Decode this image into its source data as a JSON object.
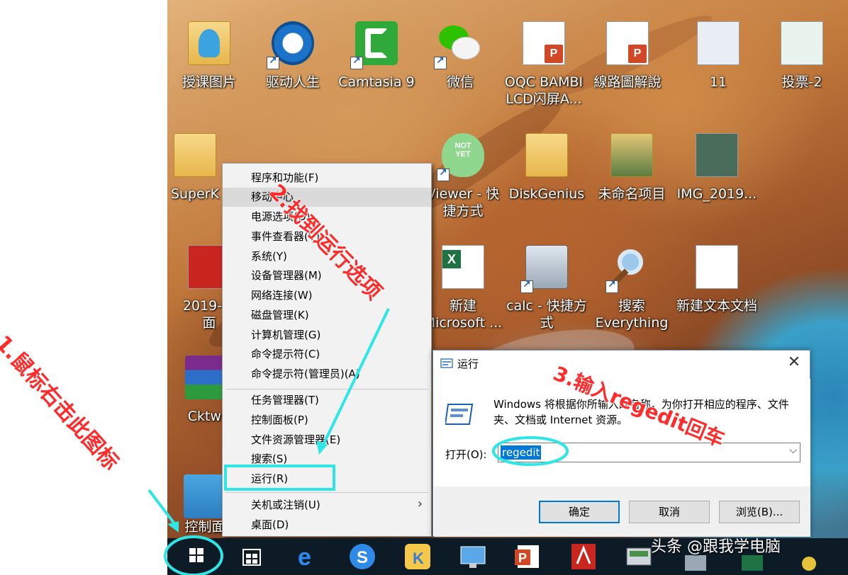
{
  "desktop": {
    "icons": [
      {
        "label": "授课图片",
        "icon": "folder-icon"
      },
      {
        "label": "驱动人生",
        "icon": "gear-icon"
      },
      {
        "label": "Camtasia 9",
        "icon": "camtasia-icon"
      },
      {
        "label": "微信",
        "icon": "wechat-icon"
      },
      {
        "label": "OQC BAMBI\nLCD闪屏A...",
        "icon": "ppt-file-icon"
      },
      {
        "label": "線路圖解說",
        "icon": "ppt-file-icon"
      },
      {
        "label": "11",
        "icon": "image-file-icon"
      },
      {
        "label": "投票-2",
        "icon": "image-file-icon"
      },
      {
        "label": "SuperK",
        "icon": "folder-icon"
      },
      {
        "label": "Viewer - 快\n捷方式",
        "icon": "viewer-icon"
      },
      {
        "label": "DiskGenius",
        "icon": "folder-icon"
      },
      {
        "label": "未命名项目",
        "icon": "folder-icon"
      },
      {
        "label": "IMG_2019...",
        "icon": "image-file-icon"
      },
      {
        "label": "2019-9-\n面",
        "icon": "pdf-file-icon"
      },
      {
        "label": "新建\nMicrosoft ...",
        "icon": "excel-file-icon"
      },
      {
        "label": "calc - 快捷方\n式",
        "icon": "calculator-icon"
      },
      {
        "label": "搜索\nEverything",
        "icon": "search-icon"
      },
      {
        "label": "新建文本文档",
        "icon": "text-file-icon"
      },
      {
        "label": "Cktwi",
        "icon": "winrar-icon"
      },
      {
        "label": "控制面",
        "icon": "control-panel-icon"
      }
    ],
    "viewer_badge": "NOT\nYET"
  },
  "context_menu": {
    "items": [
      "程序和功能(F)",
      "移动中心",
      "电源选项(O)",
      "事件查看器(V)",
      "系统(Y)",
      "设备管理器(M)",
      "网络连接(W)",
      "磁盘管理(K)",
      "计算机管理(G)",
      "命令提示符(C)",
      "命令提示符(管理员)(A)",
      "任务管理器(T)",
      "控制面板(P)",
      "文件资源管理器(E)",
      "搜索(S)",
      "运行(R)",
      "关机或注销(U)",
      "桌面(D)"
    ],
    "submenu_arrow": "›"
  },
  "run_dialog": {
    "title": "运行",
    "description": "Windows 将根据你所输入的名称，为你打开相应的程序、文件夹、文档或 Internet 资源。",
    "open_label": "打开(O):",
    "input_value": "regedit",
    "ok_label": "确定",
    "cancel_label": "取消",
    "browse_label": "浏览(B)...",
    "close_glyph": "✕",
    "dropdown_glyph": "⌵"
  },
  "annotations": {
    "step1": "1.鼠标右击此图标",
    "step2": "2.找到运行选项",
    "step3": "3.输入regedit回车",
    "color": "#ff2a2a",
    "highlight_color": "#2ee6e6"
  },
  "taskbar": {
    "watermark": "头条 @跟我学电脑",
    "apps": [
      "windows-start-icon",
      "store-icon",
      "edge-icon",
      "sogou-icon",
      "app-k-icon",
      "remote-desktop-icon",
      "powerpoint-icon",
      "acrobat-icon",
      "device-icon",
      "calculator-icon",
      "excel-icon",
      "settings-icon"
    ]
  }
}
